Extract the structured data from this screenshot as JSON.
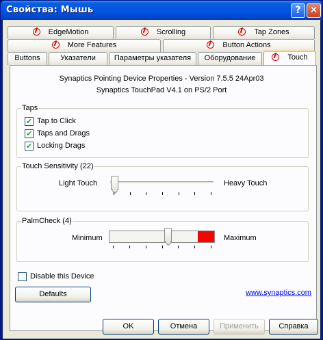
{
  "window": {
    "title": "Свойства: Мышь"
  },
  "tabs": {
    "row1": [
      {
        "label": "EdgeMotion",
        "icon": "synaptics-icon"
      },
      {
        "label": "Scrolling",
        "icon": "synaptics-icon"
      },
      {
        "label": "Tap Zones",
        "icon": "synaptics-icon"
      }
    ],
    "row2": [
      {
        "label": "More Features",
        "icon": "synaptics-icon"
      },
      {
        "label": "Button Actions",
        "icon": "synaptics-icon"
      }
    ],
    "row3": [
      {
        "label": "Buttons"
      },
      {
        "label": "Указатели"
      },
      {
        "label": "Параметры указателя"
      },
      {
        "label": "Оборудование"
      },
      {
        "label": "Touch",
        "icon": "synaptics-icon",
        "active": true
      }
    ]
  },
  "info": {
    "line1": "Synaptics Pointing Device Properties - Version 7.5.5 24Apr03",
    "line2": "Synaptics TouchPad V4.1 on PS/2 Port"
  },
  "taps": {
    "group_label": "Taps",
    "options": [
      {
        "label": "Tap to Click",
        "checked": true
      },
      {
        "label": "Taps and Drags",
        "checked": true
      },
      {
        "label": "Locking Drags",
        "checked": true
      }
    ]
  },
  "sensitivity": {
    "group_label": "Touch Sensitivity (22)",
    "min_label": "Light Touch",
    "max_label": "Heavy Touch",
    "value_fraction": 0.0
  },
  "palmcheck": {
    "group_label": "PalmCheck (4)",
    "min_label": "Minimum",
    "max_label": "Maximum",
    "value_fraction": 0.57,
    "indicator_color": "#ff0000"
  },
  "disable_device": {
    "label": "Disable this Device",
    "checked": false
  },
  "defaults_button": "Defaults",
  "link": "www.synaptics.com",
  "buttons": {
    "ok": "OK",
    "cancel": "Отмена",
    "apply": "Применить",
    "help": "Справка"
  }
}
